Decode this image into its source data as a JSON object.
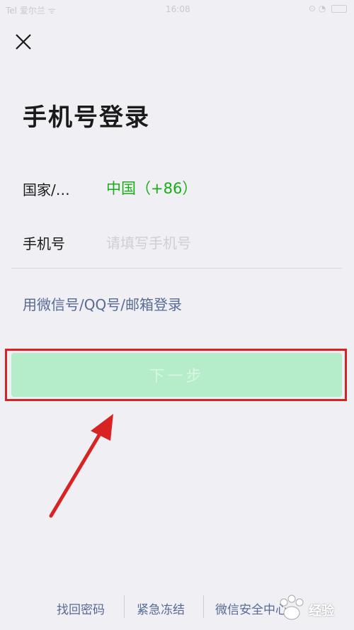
{
  "status_bar": {
    "carrier": "Tel 爱尔兰 ᯤ",
    "time": "16:08",
    "icons": "⊙ ◔"
  },
  "header": {
    "close_icon": "close-icon"
  },
  "page": {
    "title": "手机号登录"
  },
  "form": {
    "country_label": "国家/…",
    "country_value": "中国（+86）",
    "phone_label": "手机号",
    "phone_value": "",
    "phone_placeholder": "请填写手机号"
  },
  "alt_login": {
    "label": "用微信号/QQ号/邮箱登录"
  },
  "next_button": {
    "label": "下一步"
  },
  "footer": {
    "links": [
      "找回密码",
      "紧急冻结",
      "微信安全中心"
    ]
  },
  "watermark": {
    "text": "经验"
  },
  "colors": {
    "accent_green": "#1aad19",
    "link_blue": "#576b95",
    "button_disabled_bg": "#b5ecca",
    "annotation_red": "#d92323",
    "background": "#efeff4"
  }
}
